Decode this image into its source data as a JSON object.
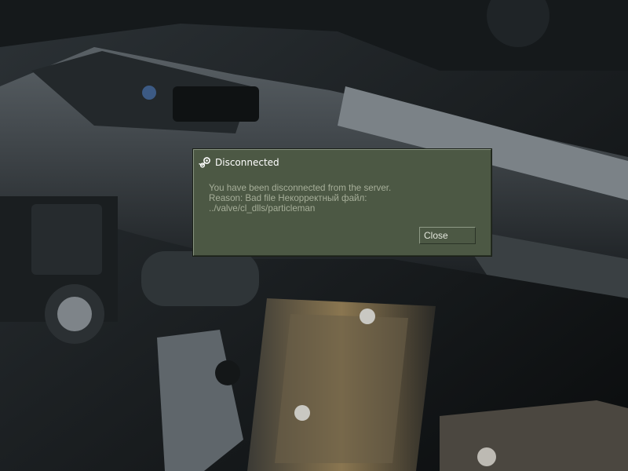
{
  "dialog": {
    "title": "Disconnected",
    "icon": "steam-icon",
    "message_line1": "You have been disconnected from the server.",
    "message_line2": "Reason: Bad file Некорректный файл:",
    "message_line3": "../valve/cl_dlls/particleman",
    "close_label": "Close"
  },
  "colors": {
    "dialog_bg": "#4c5844",
    "title_text": "#ffffff",
    "body_text": "#a6ae99"
  }
}
